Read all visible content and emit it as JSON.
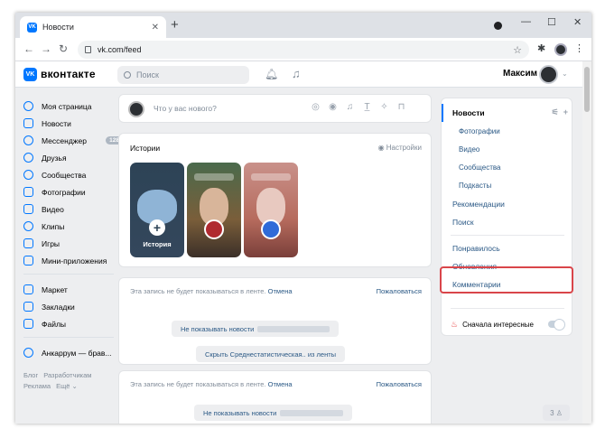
{
  "browser": {
    "tab_title": "Новости",
    "tab_favicon": "VK",
    "new_tab": "+",
    "url": "vk.com/feed",
    "controls": {
      "minimize": "—",
      "maximize": "☐",
      "close": "✕"
    }
  },
  "header": {
    "logo_text": "вконтакте",
    "logo_mark": "VK",
    "search_placeholder": "Поиск",
    "user_name": "Максим"
  },
  "sidebar": {
    "items": [
      {
        "label": "Моя страница",
        "icon": "user-circle-icon"
      },
      {
        "label": "Новости",
        "icon": "news-icon"
      },
      {
        "label": "Мессенджер",
        "icon": "message-icon",
        "badge": "128"
      },
      {
        "label": "Друзья",
        "icon": "friends-icon"
      },
      {
        "label": "Сообщества",
        "icon": "communities-icon"
      },
      {
        "label": "Фотографии",
        "icon": "photo-icon"
      },
      {
        "label": "Видео",
        "icon": "video-icon"
      },
      {
        "label": "Клипы",
        "icon": "clips-icon"
      },
      {
        "label": "Игры",
        "icon": "games-icon"
      },
      {
        "label": "Мини-приложения",
        "icon": "apps-icon"
      }
    ],
    "items2": [
      {
        "label": "Маркет",
        "icon": "market-icon"
      },
      {
        "label": "Закладки",
        "icon": "bookmark-icon"
      },
      {
        "label": "Файлы",
        "icon": "file-icon"
      }
    ],
    "items3": [
      {
        "label": "Анкаррум — брав...",
        "icon": "group-icon"
      }
    ],
    "footer": [
      "Блог",
      "Разработчикам",
      "Реклама",
      "Ещё ⌄"
    ]
  },
  "composer": {
    "placeholder": "Что у вас нового?"
  },
  "stories": {
    "title": "Истории",
    "settings": "Настройки",
    "create_label": "История"
  },
  "hidden_posts": [
    {
      "message": "Эта запись не будет показываться в ленте.",
      "undo": "Отмена",
      "report": "Пожаловаться",
      "btn1": "Не показывать новости",
      "btn2": "Скрыть Среднестатистическая.. из ленты"
    },
    {
      "message": "Эта запись не будет показываться в ленте.",
      "undo": "Отмена",
      "report": "Пожаловаться",
      "btn1": "Не показывать новости"
    }
  ],
  "filters": {
    "news": "Новости",
    "sub": [
      "Фотографии",
      "Видео",
      "Сообщества",
      "Подкасты"
    ],
    "main": [
      "Рекомендации",
      "Поиск"
    ],
    "more": [
      "Понравилось",
      "Обновления",
      "Комментарии"
    ],
    "interesting": "Сначала интересные"
  },
  "friends_chip": "3"
}
